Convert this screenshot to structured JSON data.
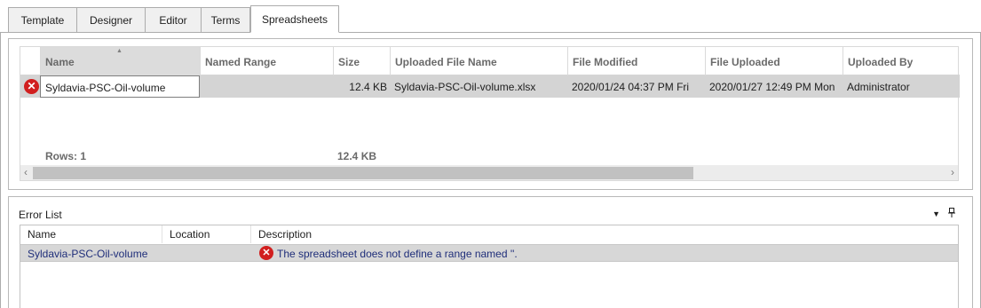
{
  "tabs": [
    {
      "label": "Template"
    },
    {
      "label": "Designer"
    },
    {
      "label": "Editor"
    },
    {
      "label": "Terms"
    },
    {
      "label": "Spreadsheets",
      "active": true
    }
  ],
  "spreadsheet_grid": {
    "columns": [
      "Name",
      "Named Range",
      "Size",
      "Uploaded File Name",
      "File Modified",
      "File Uploaded",
      "Uploaded By"
    ],
    "rows": [
      {
        "status_icon": "error-icon",
        "name": "Syldavia-PSC-Oil-volume",
        "named_range": "",
        "size": "12.4 KB",
        "uploaded_file_name": "Syldavia-PSC-Oil-volume.xlsx",
        "file_modified": "2020/01/24 04:37 PM Fri",
        "file_uploaded": "2020/01/27 12:49 PM Mon",
        "uploaded_by": "Administrator"
      }
    ],
    "footer": {
      "rows_label": "Rows: 1",
      "size_total": "12.4 KB"
    }
  },
  "error_list": {
    "title": "Error List",
    "columns": [
      "Name",
      "Location",
      "Description"
    ],
    "rows": [
      {
        "name": "Syldavia-PSC-Oil-volume",
        "location": "",
        "description": "The spreadsheet does not define a range named ''."
      }
    ]
  },
  "colors": {
    "error_red": "#d11f1f",
    "selected_row": "#d4d4d4",
    "link_text": "#1f2e7a"
  }
}
